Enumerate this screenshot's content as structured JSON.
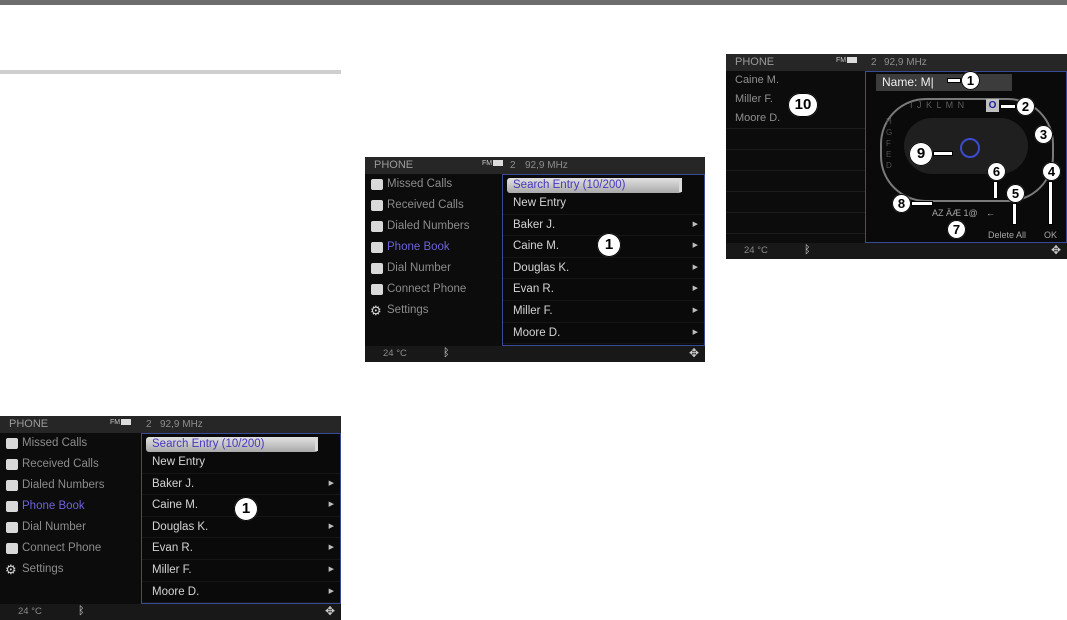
{
  "screens": {
    "phone_book": {
      "header": {
        "title": "PHONE",
        "fm": "FM",
        "channel": "2",
        "frequency": "92,9 MHz"
      },
      "menu": [
        {
          "label": "Missed Calls",
          "active": false
        },
        {
          "label": "Received Calls",
          "active": false
        },
        {
          "label": "Dialed Numbers",
          "active": false
        },
        {
          "label": "Phone Book",
          "active": true
        },
        {
          "label": "Dial Number",
          "active": false
        },
        {
          "label": "Connect Phone",
          "active": false
        },
        {
          "label": "Settings",
          "active": false
        }
      ],
      "list": {
        "search_entry": "Search Entry  (10/200)",
        "rows": [
          "New Entry",
          "Baker J.",
          "Caine M.",
          "Douglas K.",
          "Evan R.",
          "Miller F.",
          "Moore D."
        ]
      },
      "footer": {
        "temperature": "24 °C",
        "bluetooth_icon": "bluetooth-icon",
        "nav_icon": "navigation-icon"
      },
      "callout": "1"
    },
    "name_entry": {
      "header": {
        "title": "PHONE",
        "fm": "FM",
        "channel": "2",
        "frequency": "92,9 MHz"
      },
      "names": [
        "Caine M.",
        "Miller F.",
        "Moore D."
      ],
      "name_field": "Name: M|",
      "letters_top": "I J K L M N",
      "letter_selected": "O",
      "letters_side": [
        "H",
        "G",
        "F",
        "E",
        "D"
      ],
      "bottom_keys": {
        "mode": "AZ ÄÆ 1@",
        "arrow": "←",
        "delete_all": "Delete All",
        "ok": "OK"
      },
      "footer": {
        "temperature": "24 °C"
      },
      "callouts": [
        "1",
        "2",
        "3",
        "4",
        "5",
        "6",
        "7",
        "8",
        "9",
        "10"
      ]
    }
  },
  "colors": {
    "accent": "#6c63d8",
    "frame": "#3b4a96",
    "selection": "#d0d0d0"
  }
}
